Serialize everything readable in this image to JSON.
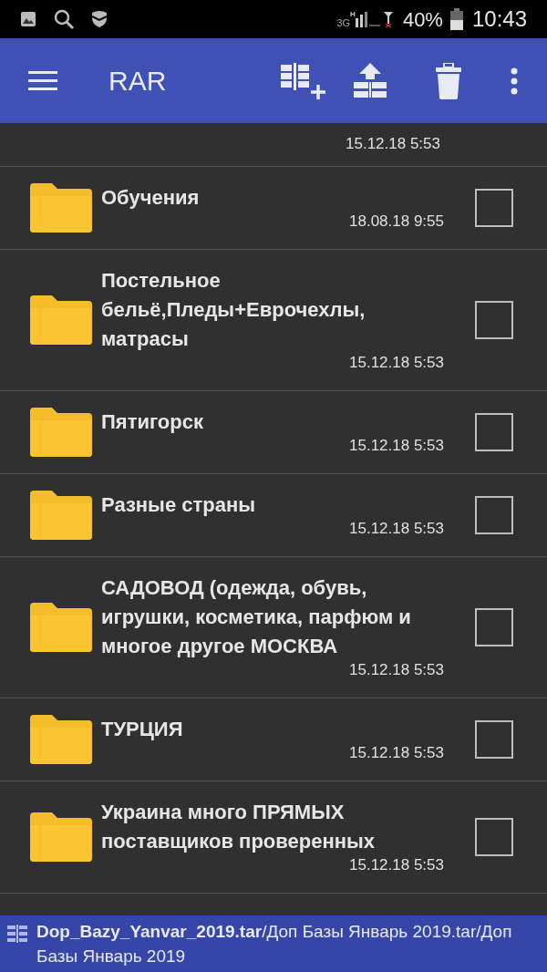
{
  "status_bar": {
    "network": "3G",
    "network_type": "H",
    "battery": "40%",
    "time": "10:43"
  },
  "toolbar": {
    "title": "RAR"
  },
  "list": {
    "partial_top_date": "15.12.18 5:53",
    "items": [
      {
        "name": "Обучения",
        "date": "18.08.18 9:55",
        "checked": false
      },
      {
        "name": "Постельное бельё,Пледы+Еврочехлы, матрасы",
        "date": "15.12.18 5:53",
        "checked": false
      },
      {
        "name": "Пятигорск",
        "date": "15.12.18 5:53",
        "checked": false
      },
      {
        "name": "Разные страны",
        "date": "15.12.18 5:53",
        "checked": false
      },
      {
        "name": "САДОВОД (одежда, обувь, игрушки, косметика, парфюм и многое другое МОСКВА",
        "date": "15.12.18 5:53",
        "checked": false
      },
      {
        "name": "ТУРЦИЯ",
        "date": "15.12.18 5:53",
        "checked": false
      },
      {
        "name": "Украина много ПРЯМЫХ поставщиков проверенных",
        "date": "15.12.18 5:53",
        "checked": false
      }
    ]
  },
  "path_bar": {
    "path": "**Dop_Bazy_Yanvar_2019.tar**/Доп Базы Январь 2019.tar/Доп Базы Январь 2019"
  }
}
